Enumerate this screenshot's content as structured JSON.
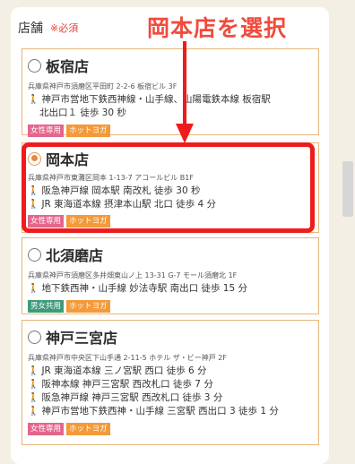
{
  "form": {
    "label": "店舗",
    "required": "※必須"
  },
  "annotation": {
    "text": "岡本店を選択",
    "color": "#f04b3c",
    "highlight_color": "#ee1c1c"
  },
  "stores": [
    {
      "name": "板宿店",
      "selected": false,
      "address": "兵庫県神戸市須磨区平田町 2-2-6 板宿ビル 3F",
      "routes": [
        {
          "line1": "神戸市営地下鉄西神線・山手線、山陽電鉄本線 板宿駅",
          "line2": "北出口１ 徒歩 30 秒"
        }
      ],
      "tags": [
        {
          "label": "女性専用",
          "color": "#e4668d"
        },
        {
          "label": "ホットヨガ",
          "color": "#f39a3a"
        }
      ]
    },
    {
      "name": "岡本店",
      "selected": true,
      "address": "兵庫県神戸市東灘区岡本 1-13-7 アコールビル B1F",
      "routes": [
        {
          "line1": "阪急神戸線 岡本駅 南改札 徒歩 30 秒"
        },
        {
          "line1": "JR 東海道本線 摂津本山駅 北口 徒歩 4 分"
        }
      ],
      "tags": [
        {
          "label": "女性専用",
          "color": "#e4668d"
        },
        {
          "label": "ホットヨガ",
          "color": "#f39a3a"
        }
      ]
    },
    {
      "name": "北須磨店",
      "selected": false,
      "address": "兵庫県神戸市須磨区多井畑東山ノ上 13-31 G-7 モール須磨北 1F",
      "routes": [
        {
          "line1": "地下鉄西神・山手線 妙法寺駅 南出口 徒歩 15 分"
        }
      ],
      "tags": [
        {
          "label": "男女共用",
          "color": "#3f9b7a"
        },
        {
          "label": "ホットヨガ",
          "color": "#f39a3a"
        }
      ]
    },
    {
      "name": "神戸三宮店",
      "selected": false,
      "address": "兵庫県神戸市中央区下山手通 2-11-5 ホテル ザ・ビー神戸 2F",
      "routes": [
        {
          "line1": "JR 東海道本線 三ノ宮駅 西口 徒歩 6 分"
        },
        {
          "line1": "阪神本線 神戸三宮駅 西改札口 徒歩 7 分"
        },
        {
          "line1": "阪急神戸線 神戸三宮駅 西改札口 徒歩 3 分"
        },
        {
          "line1": "神戸市営地下鉄西神・山手線 三宮駅 西出口 3 徒歩 1 分"
        }
      ],
      "tags": [
        {
          "label": "女性専用",
          "color": "#e4668d"
        },
        {
          "label": "ホットヨガ",
          "color": "#f39a3a"
        }
      ]
    }
  ]
}
